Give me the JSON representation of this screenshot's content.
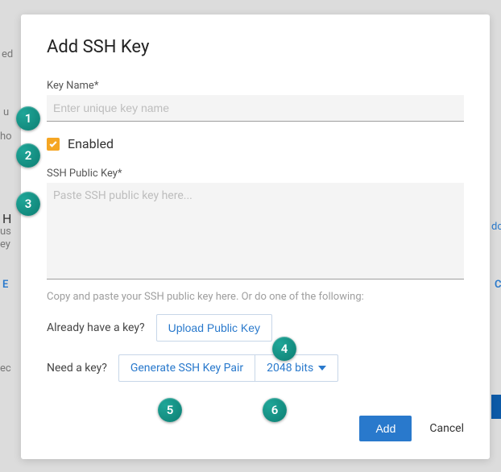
{
  "modal": {
    "title": "Add SSH Key",
    "keyName": {
      "label": "Key Name",
      "required": "*",
      "placeholder": "Enter unique key name",
      "value": ""
    },
    "enabled": {
      "label": "Enabled",
      "checked": true
    },
    "publicKey": {
      "label": "SSH Public Key",
      "required": "*",
      "placeholder": "Paste SSH public key here...",
      "value": "",
      "hint": "Copy and paste your SSH public key here. Or do one of the following:"
    },
    "already": {
      "question": "Already have a key?",
      "button": "Upload Public Key"
    },
    "need": {
      "question": "Need a key?",
      "generate": "Generate SSH Key Pair",
      "bits": "2048 bits"
    },
    "footer": {
      "add": "Add",
      "cancel": "Cancel"
    }
  },
  "badges": [
    "1",
    "2",
    "3",
    "4",
    "5",
    "6"
  ],
  "ghost": {
    "a": "ed",
    "b": "u",
    "c": "ho",
    "d": "H",
    "e": "us",
    "f": "ey",
    "g": "E",
    "h": "C",
    "i": "dc",
    "j": "ec"
  }
}
